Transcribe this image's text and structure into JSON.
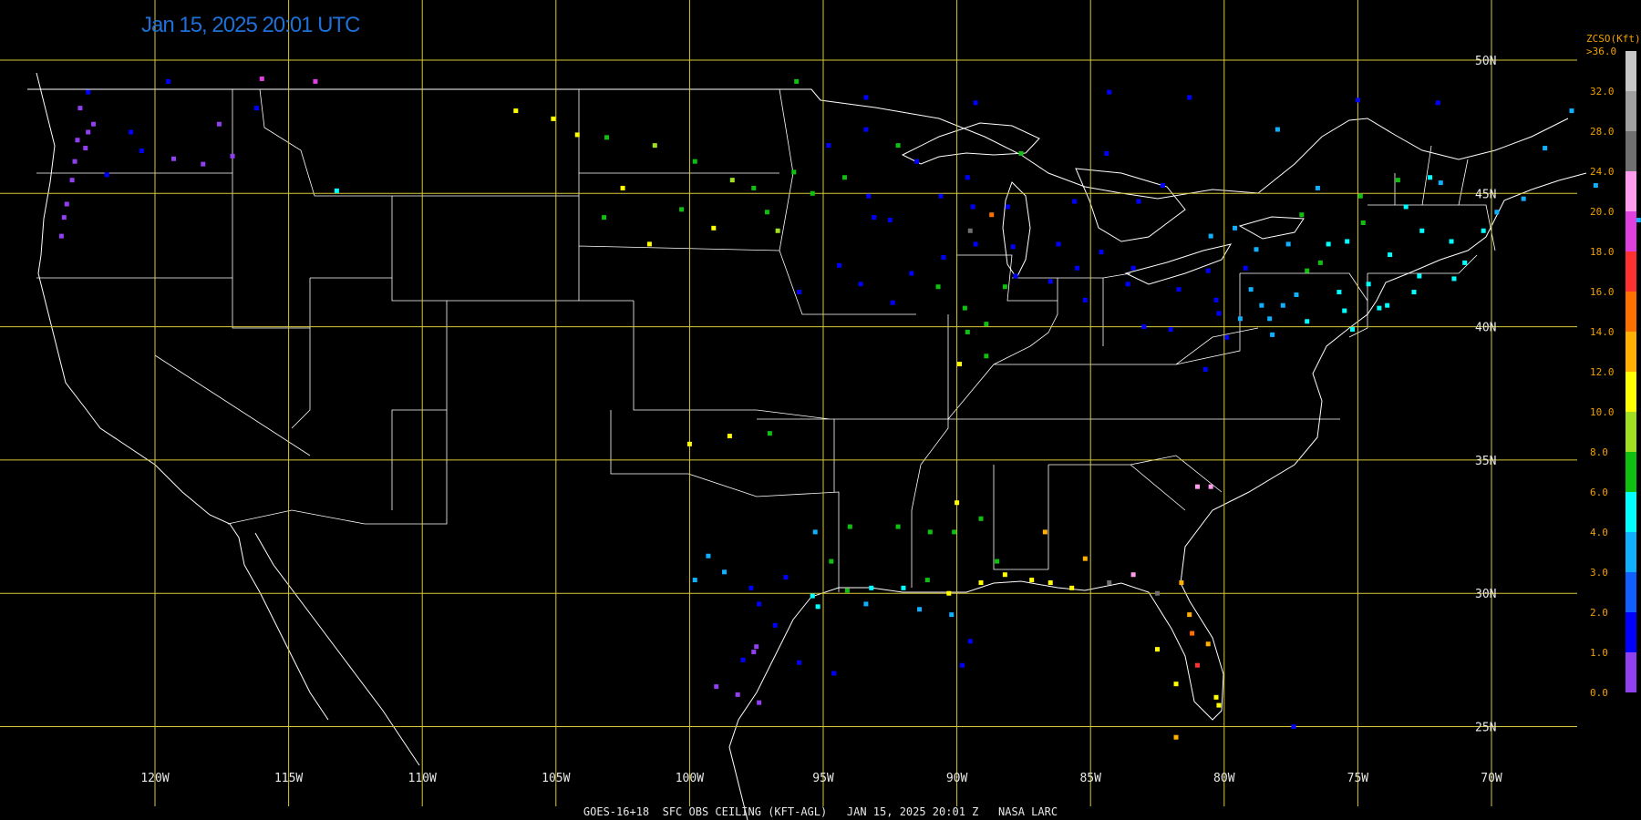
{
  "timestamp": "Jan 15, 2025 20:01 UTC",
  "footer": "GOES-16+18  SFC OBS CEILING (KFT-AGL)   JAN 15, 2025 20:01 Z   NASA LARC",
  "colors": {
    "background": "#000000",
    "grid": "#d8c838",
    "boundaries": "#ffffff",
    "title": "#1e6fd6",
    "legend_label": "#f0a000"
  },
  "grid": {
    "longitudes": [
      "120W",
      "115W",
      "110W",
      "105W",
      "100W",
      "95W",
      "90W",
      "85W",
      "80W",
      "75W",
      "70W"
    ],
    "latitudes": [
      "50N",
      "45N",
      "40N",
      "35N",
      "30N",
      "25N"
    ]
  },
  "legend": {
    "title": "ZCSO(Kft)",
    "top_label": ">36.0",
    "levels": [
      {
        "label": "32.0",
        "color": "#c8c8c8"
      },
      {
        "label": "28.0",
        "color": "#a0a0a0"
      },
      {
        "label": "24.0",
        "color": "#707070"
      },
      {
        "label": "20.0",
        "color": "#ff9cf0"
      },
      {
        "label": "18.0",
        "color": "#e040e0"
      },
      {
        "label": "16.0",
        "color": "#ff3030"
      },
      {
        "label": "14.0",
        "color": "#ff7000"
      },
      {
        "label": "12.0",
        "color": "#ffb000"
      },
      {
        "label": "10.0",
        "color": "#ffff00"
      },
      {
        "label": "8.0",
        "color": "#a0e020"
      },
      {
        "label": "6.0",
        "color": "#10c010"
      },
      {
        "label": "4.0",
        "color": "#00ffff"
      },
      {
        "label": "3.0",
        "color": "#10b0ff"
      },
      {
        "label": "2.0",
        "color": "#1060ff"
      },
      {
        "label": "1.0",
        "color": "#0000ff"
      },
      {
        "label": "0.0",
        "color": "#9040f0"
      }
    ]
  },
  "stations": [
    {
      "lon": -122.8,
      "lat": 48.2,
      "v": 0.5
    },
    {
      "lon": -122.3,
      "lat": 47.6,
      "v": 0.5
    },
    {
      "lon": -122.5,
      "lat": 47.3,
      "v": 0.5
    },
    {
      "lon": -122.9,
      "lat": 47.0,
      "v": 0.5
    },
    {
      "lon": -122.6,
      "lat": 46.7,
      "v": 0.5
    },
    {
      "lon": -123.0,
      "lat": 46.2,
      "v": 0.5
    },
    {
      "lon": -123.1,
      "lat": 45.5,
      "v": 0.5
    },
    {
      "lon": -123.3,
      "lat": 44.6,
      "v": 0.5
    },
    {
      "lon": -123.4,
      "lat": 44.1,
      "v": 0.5
    },
    {
      "lon": -123.5,
      "lat": 43.4,
      "v": 0.5
    },
    {
      "lon": -120.5,
      "lat": 46.6,
      "v": 1.5
    },
    {
      "lon": -120.9,
      "lat": 47.3,
      "v": 1.5
    },
    {
      "lon": -119.3,
      "lat": 46.3,
      "v": 0.5
    },
    {
      "lon": -118.2,
      "lat": 46.1,
      "v": 0.5
    },
    {
      "lon": -117.1,
      "lat": 46.4,
      "v": 0.5
    },
    {
      "lon": -117.6,
      "lat": 47.6,
      "v": 0.5
    },
    {
      "lon": -116.2,
      "lat": 48.2,
      "v": 1.5
    },
    {
      "lon": -122.5,
      "lat": 48.8,
      "v": 1.5
    },
    {
      "lon": -119.5,
      "lat": 49.2,
      "v": 1.5
    },
    {
      "lon": -116.0,
      "lat": 49.3,
      "v": 19.0
    },
    {
      "lon": -114.0,
      "lat": 49.2,
      "v": 19.0
    },
    {
      "lon": -121.8,
      "lat": 45.7,
      "v": 1.5
    },
    {
      "lon": -113.2,
      "lat": 45.1,
      "v": 4.5
    },
    {
      "lon": -106.5,
      "lat": 48.1,
      "v": 10.5
    },
    {
      "lon": -105.1,
      "lat": 47.8,
      "v": 10.5
    },
    {
      "lon": -104.2,
      "lat": 47.2,
      "v": 10.5
    },
    {
      "lon": -103.1,
      "lat": 47.1,
      "v": 7.0
    },
    {
      "lon": -102.5,
      "lat": 45.2,
      "v": 11.0
    },
    {
      "lon": -101.3,
      "lat": 46.8,
      "v": 9.0
    },
    {
      "lon": -99.8,
      "lat": 46.2,
      "v": 7.0
    },
    {
      "lon": -98.4,
      "lat": 45.5,
      "v": 9.0
    },
    {
      "lon": -97.6,
      "lat": 45.2,
      "v": 7.0
    },
    {
      "lon": -100.3,
      "lat": 44.4,
      "v": 7.0
    },
    {
      "lon": -101.5,
      "lat": 43.1,
      "v": 10.5
    },
    {
      "lon": -103.2,
      "lat": 44.1,
      "v": 7.0
    },
    {
      "lon": -99.1,
      "lat": 43.7,
      "v": 10.5
    },
    {
      "lon": -97.1,
      "lat": 44.3,
      "v": 7.0
    },
    {
      "lon": -96.7,
      "lat": 43.6,
      "v": 9.0
    },
    {
      "lon": -96.1,
      "lat": 45.8,
      "v": 7.0
    },
    {
      "lon": -95.4,
      "lat": 45.0,
      "v": 7.0
    },
    {
      "lon": -94.2,
      "lat": 45.6,
      "v": 7.0
    },
    {
      "lon": -93.3,
      "lat": 44.9,
      "v": 1.5
    },
    {
      "lon": -92.5,
      "lat": 44.0,
      "v": 1.5
    },
    {
      "lon": -93.1,
      "lat": 44.1,
      "v": 1.5
    },
    {
      "lon": -94.8,
      "lat": 46.8,
      "v": 1.5
    },
    {
      "lon": -93.4,
      "lat": 47.4,
      "v": 1.5
    },
    {
      "lon": -92.2,
      "lat": 46.8,
      "v": 7.0
    },
    {
      "lon": -91.5,
      "lat": 46.2,
      "v": 1.5
    },
    {
      "lon": -90.6,
      "lat": 44.9,
      "v": 1.5
    },
    {
      "lon": -89.6,
      "lat": 45.6,
      "v": 1.5
    },
    {
      "lon": -89.4,
      "lat": 44.5,
      "v": 1.5
    },
    {
      "lon": -88.1,
      "lat": 44.5,
      "v": 1.5
    },
    {
      "lon": -87.9,
      "lat": 43.0,
      "v": 1.5
    },
    {
      "lon": -89.3,
      "lat": 43.1,
      "v": 1.5
    },
    {
      "lon": -90.5,
      "lat": 42.6,
      "v": 1.5
    },
    {
      "lon": -91.7,
      "lat": 42.0,
      "v": 1.5
    },
    {
      "lon": -93.6,
      "lat": 41.6,
      "v": 1.5
    },
    {
      "lon": -94.4,
      "lat": 42.3,
      "v": 1.5
    },
    {
      "lon": -95.9,
      "lat": 41.3,
      "v": 1.5
    },
    {
      "lon": -92.4,
      "lat": 40.9,
      "v": 1.5
    },
    {
      "lon": -90.7,
      "lat": 41.5,
      "v": 7.0
    },
    {
      "lon": -89.7,
      "lat": 40.7,
      "v": 7.0
    },
    {
      "lon": -88.9,
      "lat": 40.1,
      "v": 7.0
    },
    {
      "lon": -88.2,
      "lat": 41.5,
      "v": 7.0
    },
    {
      "lon": -87.8,
      "lat": 41.9,
      "v": 1.5
    },
    {
      "lon": -89.6,
      "lat": 39.8,
      "v": 7.0
    },
    {
      "lon": -88.9,
      "lat": 38.9,
      "v": 7.0
    },
    {
      "lon": -89.9,
      "lat": 38.6,
      "v": 10.5
    },
    {
      "lon": -89.5,
      "lat": 43.6,
      "v": 26.0
    },
    {
      "lon": -88.7,
      "lat": 44.2,
      "v": 15.0
    },
    {
      "lon": -87.6,
      "lat": 46.5,
      "v": 7.0
    },
    {
      "lon": -85.6,
      "lat": 44.7,
      "v": 1.5
    },
    {
      "lon": -86.2,
      "lat": 43.1,
      "v": 1.5
    },
    {
      "lon": -85.5,
      "lat": 42.2,
      "v": 1.5
    },
    {
      "lon": -84.6,
      "lat": 42.8,
      "v": 1.5
    },
    {
      "lon": -83.4,
      "lat": 42.2,
      "v": 1.5
    },
    {
      "lon": -84.4,
      "lat": 46.5,
      "v": 1.5
    },
    {
      "lon": -82.3,
      "lat": 45.3,
      "v": 1.5
    },
    {
      "lon": -83.2,
      "lat": 44.7,
      "v": 1.5
    },
    {
      "lon": -86.5,
      "lat": 41.7,
      "v": 1.5
    },
    {
      "lon": -85.2,
      "lat": 41.0,
      "v": 1.5
    },
    {
      "lon": -83.6,
      "lat": 41.6,
      "v": 1.5
    },
    {
      "lon": -81.7,
      "lat": 41.4,
      "v": 1.5
    },
    {
      "lon": -80.3,
      "lat": 41.0,
      "v": 1.5
    },
    {
      "lon": -80.2,
      "lat": 40.5,
      "v": 1.5
    },
    {
      "lon": -79.9,
      "lat": 39.6,
      "v": 1.5
    },
    {
      "lon": -78.8,
      "lat": 42.9,
      "v": 3.5
    },
    {
      "lon": -77.6,
      "lat": 43.1,
      "v": 3.5
    },
    {
      "lon": -76.1,
      "lat": 43.1,
      "v": 4.5
    },
    {
      "lon": -75.4,
      "lat": 43.2,
      "v": 4.5
    },
    {
      "lon": -73.8,
      "lat": 42.7,
      "v": 4.5
    },
    {
      "lon": -73.2,
      "lat": 44.5,
      "v": 4.5
    },
    {
      "lon": -72.6,
      "lat": 43.6,
      "v": 4.5
    },
    {
      "lon": -71.5,
      "lat": 43.2,
      "v": 4.5
    },
    {
      "lon": -70.3,
      "lat": 43.6,
      "v": 4.5
    },
    {
      "lon": -69.8,
      "lat": 44.3,
      "v": 3.5
    },
    {
      "lon": -68.8,
      "lat": 44.8,
      "v": 3.5
    },
    {
      "lon": -68.0,
      "lat": 46.7,
      "v": 3.5
    },
    {
      "lon": -71.0,
      "lat": 42.4,
      "v": 4.5
    },
    {
      "lon": -72.7,
      "lat": 41.9,
      "v": 4.5
    },
    {
      "lon": -73.9,
      "lat": 40.8,
      "v": 4.5
    },
    {
      "lon": -74.2,
      "lat": 40.7,
      "v": 4.5
    },
    {
      "lon": -75.2,
      "lat": 39.9,
      "v": 4.5
    },
    {
      "lon": -75.5,
      "lat": 40.6,
      "v": 4.5
    },
    {
      "lon": -76.9,
      "lat": 40.2,
      "v": 4.5
    },
    {
      "lon": -77.8,
      "lat": 40.8,
      "v": 3.5
    },
    {
      "lon": -79.0,
      "lat": 41.4,
      "v": 3.5
    },
    {
      "lon": -76.4,
      "lat": 42.4,
      "v": 7.0
    },
    {
      "lon": -77.1,
      "lat": 44.2,
      "v": 7.0
    },
    {
      "lon": -74.9,
      "lat": 44.9,
      "v": 7.0
    },
    {
      "lon": -73.5,
      "lat": 45.5,
      "v": 7.0
    },
    {
      "lon": -71.9,
      "lat": 45.4,
      "v": 3.5
    },
    {
      "lon": -76.5,
      "lat": 45.2,
      "v": 3.5
    },
    {
      "lon": -79.6,
      "lat": 43.7,
      "v": 3.5
    },
    {
      "lon": -80.5,
      "lat": 43.4,
      "v": 3.5
    },
    {
      "lon": -78.0,
      "lat": 47.4,
      "v": 3.5
    },
    {
      "lon": -75.0,
      "lat": 48.5,
      "v": 1.5
    },
    {
      "lon": -72.0,
      "lat": 48.4,
      "v": 1.5
    },
    {
      "lon": -67.0,
      "lat": 48.1,
      "v": 3.5
    },
    {
      "lon": -66.1,
      "lat": 45.3,
      "v": 3.5
    },
    {
      "lon": -64.5,
      "lat": 44.0,
      "v": 3.5
    },
    {
      "lon": -63.5,
      "lat": 44.9,
      "v": 3.5
    },
    {
      "lon": -82.0,
      "lat": 39.9,
      "v": 1.5
    },
    {
      "lon": -80.7,
      "lat": 38.4,
      "v": 1.5
    },
    {
      "lon": -96.0,
      "lat": 49.2,
      "v": 7.0
    },
    {
      "lon": -93.4,
      "lat": 48.6,
      "v": 1.5
    },
    {
      "lon": -89.3,
      "lat": 48.4,
      "v": 1.5
    },
    {
      "lon": -84.3,
      "lat": 48.8,
      "v": 1.5
    },
    {
      "lon": -81.3,
      "lat": 48.6,
      "v": 1.5
    },
    {
      "lon": -100.0,
      "lat": 35.6,
      "v": 11.0
    },
    {
      "lon": -98.5,
      "lat": 35.9,
      "v": 11.0
    },
    {
      "lon": -97.0,
      "lat": 36.0,
      "v": 7.0
    },
    {
      "lon": -99.3,
      "lat": 31.4,
      "v": 3.5
    },
    {
      "lon": -98.7,
      "lat": 30.8,
      "v": 3.5
    },
    {
      "lon": -99.8,
      "lat": 30.5,
      "v": 3.5
    },
    {
      "lon": -97.7,
      "lat": 30.2,
      "v": 1.5
    },
    {
      "lon": -97.4,
      "lat": 29.6,
      "v": 1.5
    },
    {
      "lon": -96.4,
      "lat": 30.6,
      "v": 1.5
    },
    {
      "lon": -95.4,
      "lat": 29.9,
      "v": 4.5
    },
    {
      "lon": -95.2,
      "lat": 29.5,
      "v": 4.5
    },
    {
      "lon": -94.1,
      "lat": 30.1,
      "v": 7.0
    },
    {
      "lon": -93.2,
      "lat": 30.2,
      "v": 4.5
    },
    {
      "lon": -92.0,
      "lat": 30.2,
      "v": 4.5
    },
    {
      "lon": -91.1,
      "lat": 30.5,
      "v": 7.0
    },
    {
      "lon": -90.3,
      "lat": 30.0,
      "v": 10.5
    },
    {
      "lon": -89.1,
      "lat": 30.4,
      "v": 10.5
    },
    {
      "lon": -88.2,
      "lat": 30.7,
      "v": 10.5
    },
    {
      "lon": -87.2,
      "lat": 30.5,
      "v": 10.5
    },
    {
      "lon": -86.5,
      "lat": 30.4,
      "v": 10.5
    },
    {
      "lon": -85.7,
      "lat": 30.2,
      "v": 10.5
    },
    {
      "lon": -84.3,
      "lat": 30.4,
      "v": 26.0
    },
    {
      "lon": -82.5,
      "lat": 30.0,
      "v": 26.0
    },
    {
      "lon": -81.6,
      "lat": 30.4,
      "v": 13.0
    },
    {
      "lon": -81.3,
      "lat": 29.2,
      "v": 13.0
    },
    {
      "lon": -81.2,
      "lat": 28.5,
      "v": 15.0
    },
    {
      "lon": -80.6,
      "lat": 28.1,
      "v": 13.0
    },
    {
      "lon": -82.5,
      "lat": 27.9,
      "v": 11.0
    },
    {
      "lon": -81.8,
      "lat": 26.6,
      "v": 11.0
    },
    {
      "lon": -80.3,
      "lat": 26.1,
      "v": 11.0
    },
    {
      "lon": -80.2,
      "lat": 25.8,
      "v": 11.0
    },
    {
      "lon": -81.8,
      "lat": 24.6,
      "v": 13.0
    },
    {
      "lon": -81.0,
      "lat": 27.3,
      "v": 17.0
    },
    {
      "lon": -92.2,
      "lat": 32.5,
      "v": 7.0
    },
    {
      "lon": -91.0,
      "lat": 32.3,
      "v": 7.0
    },
    {
      "lon": -90.1,
      "lat": 32.3,
      "v": 7.0
    },
    {
      "lon": -89.1,
      "lat": 32.8,
      "v": 7.0
    },
    {
      "lon": -88.5,
      "lat": 31.2,
      "v": 7.0
    },
    {
      "lon": -90.0,
      "lat": 33.4,
      "v": 11.0
    },
    {
      "lon": -86.7,
      "lat": 32.3,
      "v": 13.0
    },
    {
      "lon": -85.2,
      "lat": 31.3,
      "v": 13.0
    },
    {
      "lon": -94.0,
      "lat": 32.5,
      "v": 7.0
    },
    {
      "lon": -94.7,
      "lat": 31.2,
      "v": 7.0
    },
    {
      "lon": -95.3,
      "lat": 32.3,
      "v": 3.5
    },
    {
      "lon": -97.5,
      "lat": 28.0,
      "v": 0.5
    },
    {
      "lon": -97.6,
      "lat": 27.8,
      "v": 0.5
    },
    {
      "lon": -98.2,
      "lat": 26.2,
      "v": 0.5
    },
    {
      "lon": -97.4,
      "lat": 25.9,
      "v": 0.5
    },
    {
      "lon": -99.0,
      "lat": 26.5,
      "v": 0.5
    },
    {
      "lon": -98.0,
      "lat": 27.5,
      "v": 1.5
    },
    {
      "lon": -96.8,
      "lat": 28.8,
      "v": 1.5
    },
    {
      "lon": -95.9,
      "lat": 27.4,
      "v": 1.5
    },
    {
      "lon": -94.6,
      "lat": 27.0,
      "v": 1.5
    },
    {
      "lon": -89.8,
      "lat": 27.3,
      "v": 1.5
    },
    {
      "lon": -89.5,
      "lat": 28.2,
      "v": 1.5
    },
    {
      "lon": -93.4,
      "lat": 29.6,
      "v": 3.5
    },
    {
      "lon": -91.4,
      "lat": 29.4,
      "v": 3.5
    },
    {
      "lon": -90.2,
      "lat": 29.2,
      "v": 3.5
    },
    {
      "lon": -81.0,
      "lat": 34.0,
      "v": 23.0
    },
    {
      "lon": -80.5,
      "lat": 34.0,
      "v": 23.0
    },
    {
      "lon": -83.4,
      "lat": 30.7,
      "v": 23.0
    },
    {
      "lon": -77.4,
      "lat": 25.0,
      "v": 1.5
    },
    {
      "lon": -72.3,
      "lat": 45.6,
      "v": 4.5
    },
    {
      "lon": -71.4,
      "lat": 41.8,
      "v": 4.5
    },
    {
      "lon": -72.9,
      "lat": 41.3,
      "v": 4.5
    },
    {
      "lon": -74.6,
      "lat": 41.6,
      "v": 4.5
    },
    {
      "lon": -77.3,
      "lat": 41.2,
      "v": 3.5
    },
    {
      "lon": -78.3,
      "lat": 40.3,
      "v": 3.5
    },
    {
      "lon": -79.4,
      "lat": 40.3,
      "v": 3.5
    },
    {
      "lon": -78.2,
      "lat": 39.7,
      "v": 3.5
    },
    {
      "lon": -75.7,
      "lat": 41.3,
      "v": 4.5
    },
    {
      "lon": -74.8,
      "lat": 43.9,
      "v": 7.0
    },
    {
      "lon": -76.9,
      "lat": 42.1,
      "v": 7.0
    },
    {
      "lon": -79.2,
      "lat": 42.2,
      "v": 1.5
    },
    {
      "lon": -78.6,
      "lat": 40.8,
      "v": 3.5
    },
    {
      "lon": -80.6,
      "lat": 42.1,
      "v": 1.5
    },
    {
      "lon": -83.0,
      "lat": 40.0,
      "v": 1.5
    }
  ]
}
